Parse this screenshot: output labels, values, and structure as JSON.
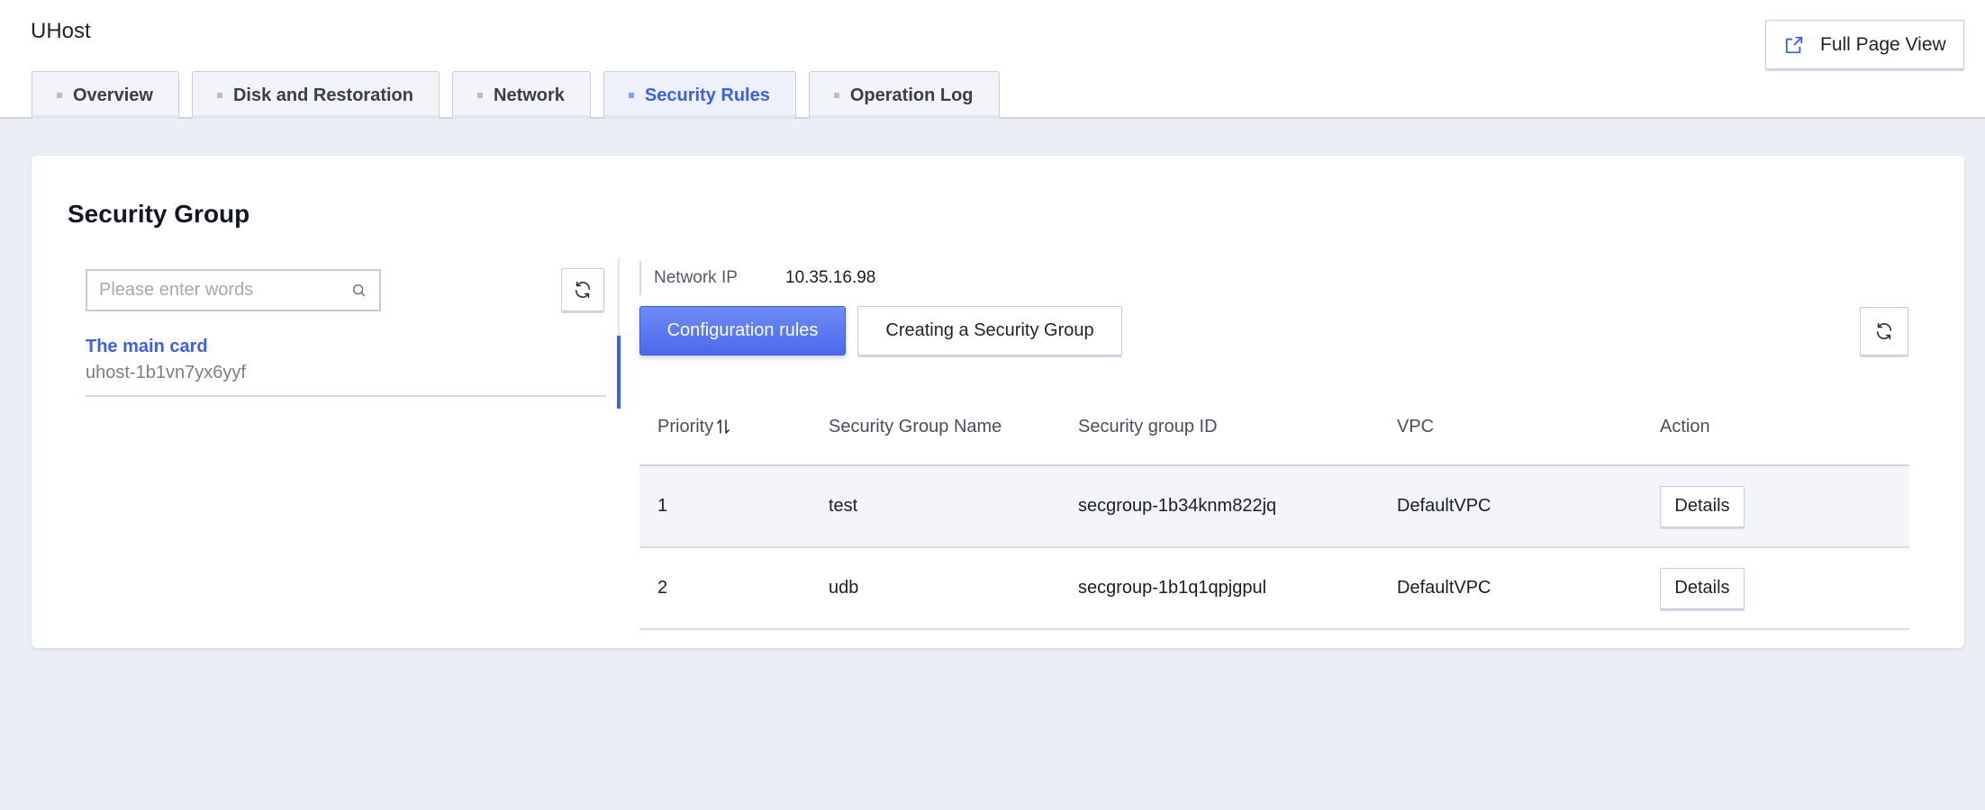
{
  "header": {
    "app_title": "UHost",
    "full_page_view_label": "Full Page View"
  },
  "tabs": [
    {
      "label": "Overview",
      "active": false
    },
    {
      "label": "Disk and Restoration",
      "active": false
    },
    {
      "label": "Network",
      "active": false
    },
    {
      "label": "Security Rules",
      "active": true
    },
    {
      "label": "Operation Log",
      "active": false
    }
  ],
  "security_group": {
    "title": "Security Group",
    "search": {
      "placeholder": "Please enter words",
      "value": ""
    },
    "list": [
      {
        "title": "The main card",
        "subtitle": "uhost-1b1vn7yx6yyf",
        "selected": true
      }
    ],
    "network_ip": {
      "label": "Network IP",
      "value": "10.35.16.98"
    },
    "buttons": {
      "configuration_rules": "Configuration rules",
      "create_security_group": "Creating a Security Group"
    },
    "table": {
      "columns": [
        "Priority",
        "Security Group Name",
        "Security group ID",
        "VPC",
        "Action"
      ],
      "rows": [
        {
          "priority": "1",
          "name": "test",
          "id": "secgroup-1b34knm822jq",
          "vpc": "DefaultVPC",
          "action": "Details"
        },
        {
          "priority": "2",
          "name": "udb",
          "id": "secgroup-1b1q1qpjgpul",
          "vpc": "DefaultVPC",
          "action": "Details"
        }
      ]
    }
  },
  "colors": {
    "accent": "#3d5fe0",
    "background": "#eceef6"
  }
}
